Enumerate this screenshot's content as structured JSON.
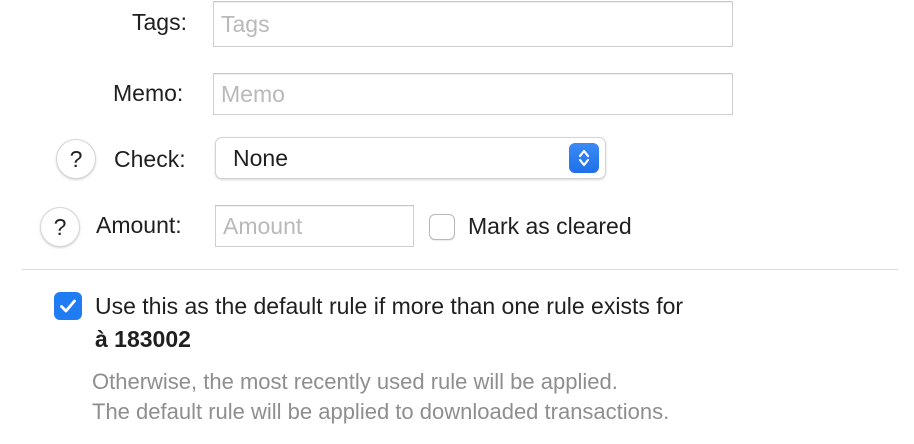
{
  "fields": {
    "tags": {
      "label": "Tags:",
      "placeholder": "Tags"
    },
    "memo": {
      "label": "Memo:",
      "placeholder": "Memo"
    },
    "check": {
      "label": "Check:",
      "selected": "None"
    },
    "amount": {
      "label": "Amount:",
      "placeholder": "Amount"
    }
  },
  "help_button": {
    "glyph": "?"
  },
  "mark_cleared": {
    "label": "Mark as cleared",
    "checked": false
  },
  "default_rule": {
    "checked": true,
    "label_line1": "Use this as the default rule if more than one rule exists for",
    "payee": "à 183002",
    "note_line1": "Otherwise, the most recently used rule will be applied.",
    "note_line2": "The default rule will be applied to downloaded transactions."
  },
  "colors": {
    "accent": "#1f7cf2",
    "secondary_text": "#8e8e8e",
    "separator": "#dcdcdc"
  }
}
